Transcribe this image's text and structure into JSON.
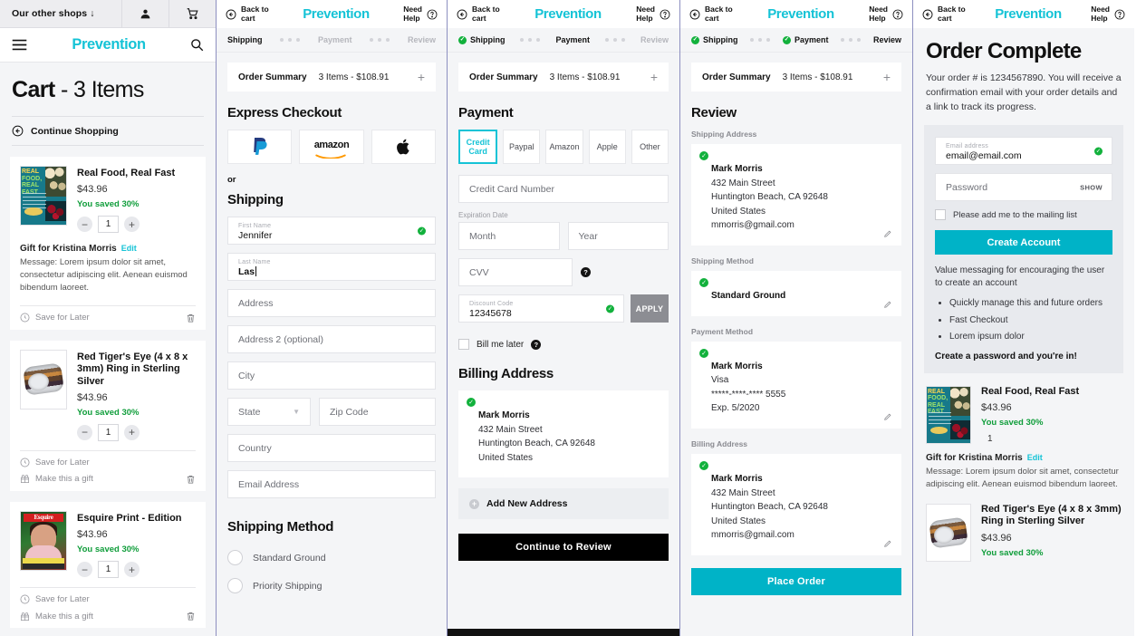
{
  "brand": "Prevention",
  "cart_panel": {
    "topbar": {
      "other_shops": "Our other shops",
      "account_icon": "person-icon",
      "cart_icon": "cart-icon"
    },
    "header": {
      "menu_icon": "hamburger-icon",
      "logo": "Prevention",
      "search_icon": "search-icon"
    },
    "title_bold": "Cart",
    "title_rest": " - 3 Items",
    "continue_shopping": "Continue Shopping",
    "items": [
      {
        "name": "Real Food, Real Fast",
        "price": "$43.96",
        "saved": "You saved 30%",
        "qty": "1",
        "art": "book",
        "gift_title": "Gift for Kristina Morris",
        "gift_edit": "Edit",
        "gift_message": "Message:  Lorem ipsum dolor sit amet, consectetur adipiscing elit. Aenean euismod bibendum laoreet.",
        "save_for_later": "Save for Later",
        "make_gift": null
      },
      {
        "name": "Red Tiger's Eye (4 x 8 x 3mm) Ring in Sterling Silver",
        "price": "$43.96",
        "saved": "You saved 30%",
        "qty": "1",
        "art": "ring",
        "save_for_later": "Save for Later",
        "make_gift": "Make this a gift"
      },
      {
        "name": "Esquire Print - Edition",
        "price": "$43.96",
        "saved": "You saved 30%",
        "qty": "1",
        "art": "magazine",
        "save_for_later": "Save for Later",
        "make_gift": "Make this a gift"
      }
    ]
  },
  "checkout_header": {
    "back_to_cart": "Back to\ncart",
    "back_line1": "Back to",
    "back_line2": "cart",
    "need_help_line1": "Need",
    "need_help_line2": "Help",
    "logo": "Prevention"
  },
  "steps": {
    "shipping": "Shipping",
    "payment": "Payment",
    "review": "Review"
  },
  "order_summary": {
    "label": "Order Summary",
    "items": "3 Items - $108.91",
    "expand": "+"
  },
  "shipping_panel": {
    "express_title": "Express Checkout",
    "methods": [
      {
        "name": "paypal-logo",
        "label": "PayPal"
      },
      {
        "name": "amazon-logo",
        "label": "amazon"
      },
      {
        "name": "apple-logo",
        "label": "Apple"
      }
    ],
    "or": "or",
    "shipping_title": "Shipping",
    "first_name": {
      "label": "First Name",
      "value": "Jennifer"
    },
    "last_name": {
      "label": "Last Name",
      "value": "Las"
    },
    "address": "Address",
    "address2": "Address 2 (optional)",
    "city": "City",
    "state": "State",
    "zip": "Zip Code",
    "country": "Country",
    "email": "Email Address",
    "shipping_method_title": "Shipping Method",
    "shipping_options": [
      "Standard Ground",
      "Priority Shipping"
    ]
  },
  "payment_panel": {
    "title": "Payment",
    "tabs": [
      "Credit Card",
      "Paypal",
      "Amazon",
      "Apple",
      "Other"
    ],
    "active_tab": "Credit Card",
    "card_number": "Credit Card Number",
    "expiration_label": "Expiration Date",
    "month": "Month",
    "year": "Year",
    "cvv": "CVV",
    "discount": {
      "label": "Discount Code",
      "value": "12345678",
      "apply": "APPLY"
    },
    "bill_me_later": "Bill me later",
    "billing_title": "Billing Address",
    "billing_address": {
      "name": "Mark Morris",
      "street": "432 Main Street",
      "citystate": "Huntington Beach, CA 92648",
      "country": "United States"
    },
    "add_new_address": "Add New Address",
    "continue": "Continue to Review"
  },
  "review_panel": {
    "title": "Review",
    "shipping_address_label": "Shipping Address",
    "shipping_address": {
      "name": "Mark Morris",
      "street": "432 Main Street",
      "citystate": "Huntington Beach, CA 92648",
      "country": "United States",
      "email": "mmorris@gmail.com"
    },
    "shipping_method_label": "Shipping Method",
    "shipping_method": "Standard Ground",
    "payment_method_label": "Payment Method",
    "payment_method": {
      "name": "Mark Morris",
      "brand": "Visa",
      "number": "*****-****-**** 5555",
      "exp": "Exp. 5/2020"
    },
    "billing_address_label": "Billing Address",
    "billing_address": {
      "name": "Mark Morris",
      "street": "432 Main Street",
      "citystate": "Huntington Beach, CA 92648",
      "country": "United States",
      "email": "mmorris@gmail.com"
    },
    "place_order": "Place Order"
  },
  "complete_panel": {
    "title": "Order Complete",
    "body": "Your order # is 1234567890. You will receive a confirmation email with your order details and a link to track its progress.",
    "email_field": {
      "label": "Email address",
      "value": "email@email.com"
    },
    "password_field": {
      "placeholder": "Password",
      "show": "SHOW"
    },
    "mailing_list": "Please add me to the mailing list",
    "create_account": "Create Account",
    "value_messaging": "Value messaging for encouraging the user to create an account",
    "benefits": [
      "Quickly manage this and future orders",
      "Fast Checkout",
      "Lorem ipsum dolor"
    ],
    "closer": "Create a password and you're in!",
    "items": [
      {
        "name": "Real Food, Real Fast",
        "price": "$43.96",
        "saved": "You saved 30%",
        "qty": "1",
        "art": "book",
        "gift_title": "Gift for Kristina Morris",
        "gift_edit": "Edit",
        "gift_message": "Message:  Lorem ipsum dolor sit amet, consectetur adipiscing elit. Aenean euismod bibendum laoreet."
      },
      {
        "name": "Red Tiger's Eye (4 x 8 x 3mm) Ring in Sterling Silver",
        "price": "$43.96",
        "saved": "You saved 30%",
        "art": "ring"
      }
    ]
  },
  "colors": {
    "brand_teal": "#15c3d6",
    "button_teal": "#00b3c7",
    "success_green": "#12b13c",
    "saved_green": "#0f9d3a",
    "page_bg": "#f4f5f7",
    "dark_button": "#000000"
  }
}
